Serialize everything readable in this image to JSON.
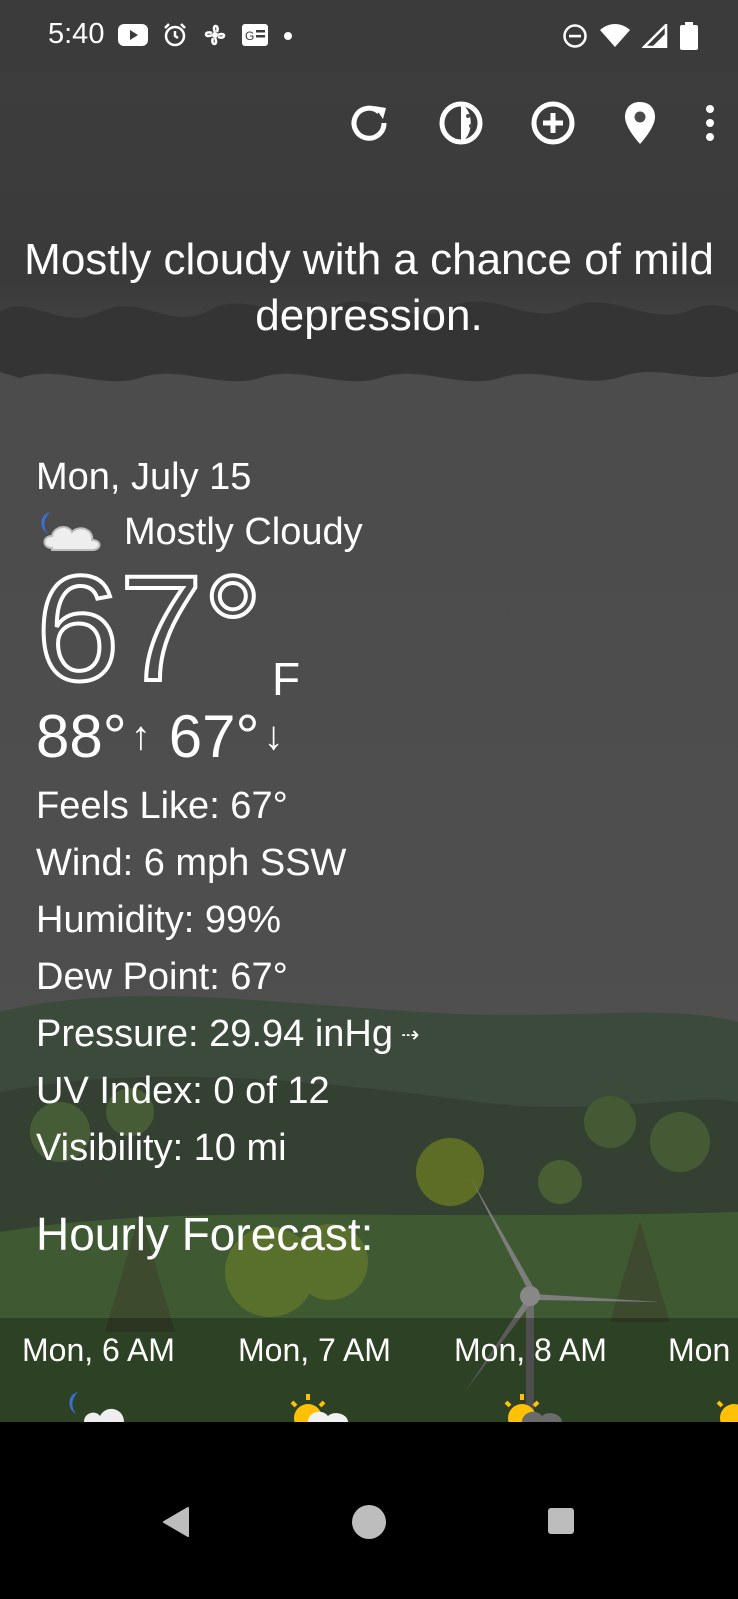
{
  "status_bar": {
    "time": "5:40",
    "left_icons": [
      "youtube-icon",
      "alarm-icon",
      "fan-icon",
      "news-icon",
      "dot-icon"
    ],
    "right_icons": [
      "do-not-disturb-icon",
      "wifi-icon",
      "signal-icon",
      "battery-icon"
    ]
  },
  "toolbar": {
    "icons": [
      "refresh-icon",
      "theme-icon",
      "add-location-icon",
      "location-pin-icon",
      "overflow-menu-icon"
    ]
  },
  "tagline": "Mostly cloudy with a chance of mild depression.",
  "current": {
    "date": "Mon, July 15",
    "condition": "Mostly Cloudy",
    "condition_icon": "partly-cloudy-night-icon",
    "temperature": "67°",
    "unit": "F",
    "high": "88°",
    "low": "67°",
    "feels_like": "Feels Like:  67°",
    "wind": "Wind:  6 mph SSW",
    "humidity": "Humidity:  99%",
    "dew_point": "Dew Point:  67°",
    "pressure": "Pressure:  29.94 inHg",
    "uv_index": "UV Index:  0 of 12",
    "visibility": "Visibility:  10 mi"
  },
  "hourly": {
    "title": "Hourly Forecast:",
    "items": [
      {
        "label": "Mon, 6 AM",
        "icon": "partly-cloudy-night-icon"
      },
      {
        "label": "Mon, 7 AM",
        "icon": "partly-sunny-icon"
      },
      {
        "label": "Mon, 8 AM",
        "icon": "partly-sunny-cloudy-icon"
      },
      {
        "label": "Mon",
        "icon": "sun-icon"
      }
    ]
  },
  "colors": {
    "status_bar": "#3b3b3b",
    "background": "#4e4e4e",
    "text": "#ffffff",
    "nav_bar": "#000000"
  }
}
